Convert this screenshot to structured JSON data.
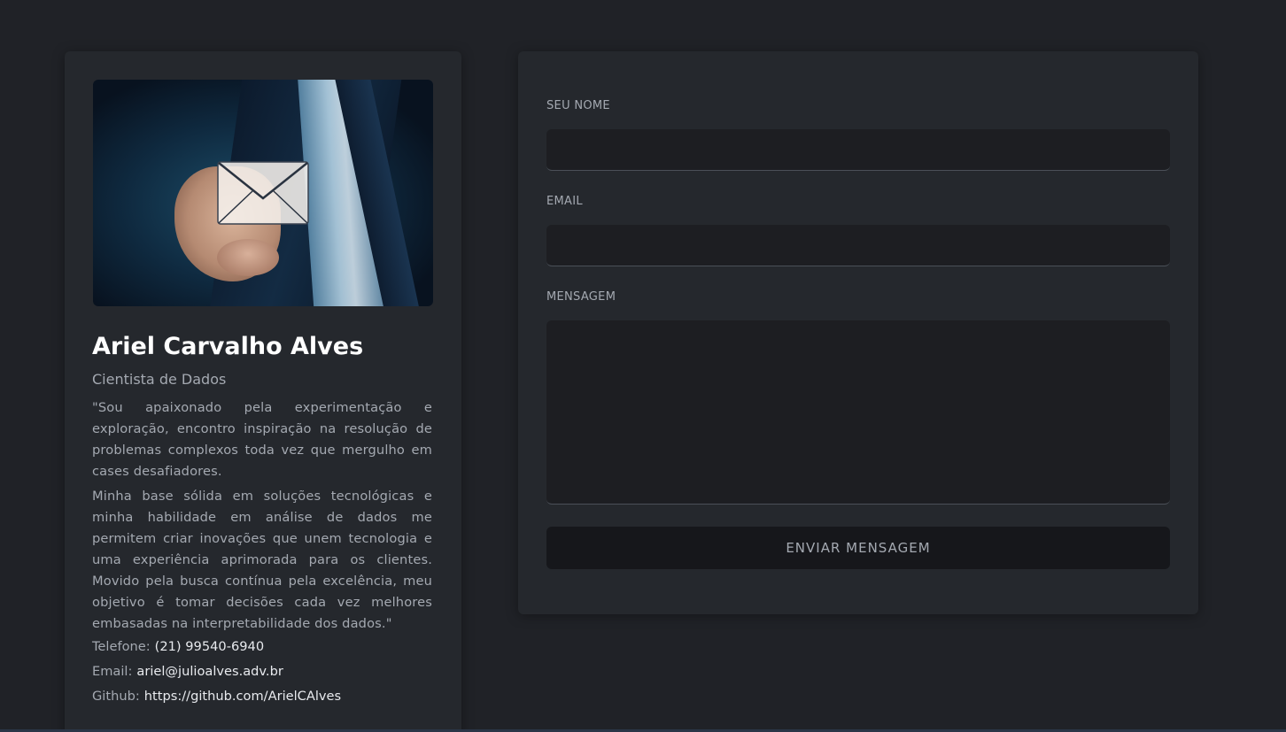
{
  "profile": {
    "image_alt": "hand-envelope-photo",
    "name": "Ariel Carvalho Alves",
    "title": "Cientista de Dados",
    "bio": [
      "\"Sou apaixonado pela experimentação e exploração, encontro inspiração na resolução de problemas complexos toda vez que mergulho em cases desafiadores.",
      "Minha base sólida em soluções tecnológicas e minha habilidade em análise de dados me permitem criar inovações que unem tecnologia e uma experiência aprimorada para os clientes. Movido pela busca contínua pela excelência, meu objetivo é tomar decisões cada vez melhores embasadas na interpretabilidade dos dados.\""
    ],
    "contacts": {
      "phone_label": "Telefone:",
      "phone": "(21) 99540-6940",
      "email_label": "Email:",
      "email": "ariel@julioalves.adv.br",
      "github_label": "Github:",
      "github": "https://github.com/ArielCAlves"
    }
  },
  "form": {
    "name_label": "SEU NOME",
    "name_value": "",
    "email_label": "EMAIL",
    "email_value": "",
    "message_label": "MENSAGEM",
    "message_value": "",
    "submit_label": "ENVIAR MENSAGEM"
  },
  "colors": {
    "background": "#202227",
    "card": "#25282d",
    "input": "#1d1e22",
    "button": "#16171b",
    "muted_text": "#a4a9b1",
    "heading": "#ffffff"
  }
}
